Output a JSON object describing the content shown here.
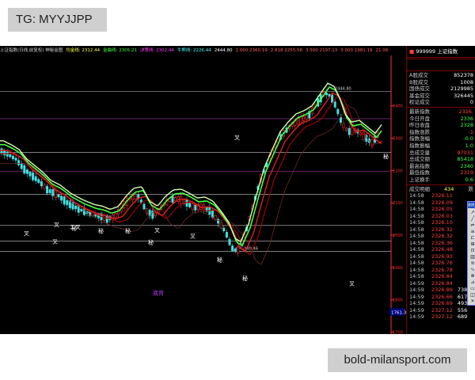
{
  "watermarks": {
    "top": "TG: MYYJJPP",
    "bottom": "bold-milansport.com"
  },
  "topbar": {
    "items": [
      {
        "text": "上证指数(日线,前复权) 神秘金图",
        "color": "#d0d0d0"
      },
      {
        "text": "均金线: 2312.44",
        "color": "#ffff40"
      },
      {
        "text": "金曲线: 2305.21",
        "color": "#40ff40"
      },
      {
        "text": "决策线: 2302.44",
        "color": "#ff40ff"
      },
      {
        "text": "牛熊线: 2226.44",
        "color": "#40ffff"
      },
      {
        "text": "2444.80",
        "color": "#ffffff"
      },
      {
        "text": "1.000 2360.19",
        "color": "#ff6060"
      },
      {
        "text": "2.618 2255.58",
        "color": "#ff6060"
      },
      {
        "text": "3.500 2197.13",
        "color": "#ff6060"
      },
      {
        "text": "5.000 1981.19",
        "color": "#ff6060"
      },
      {
        "text": "21.06",
        "color": "#ff6060"
      }
    ]
  },
  "chart_data": {
    "type": "candlestick",
    "title": "上证指数(日线,前复权)",
    "ylim": [
      1650,
      2600
    ],
    "y_ticks": [
      2400,
      2300,
      2200,
      2100,
      2000,
      1900,
      1800,
      1700
    ],
    "ohlc_generator": "synthetic approximation of 上证指数 daily candles",
    "price_path": [
      [
        0,
        2262
      ],
      [
        10,
        2250
      ],
      [
        20,
        2235
      ],
      [
        30,
        2205
      ],
      [
        40,
        2185
      ],
      [
        50,
        2165
      ],
      [
        60,
        2140
      ],
      [
        72,
        2125
      ],
      [
        85,
        2100
      ],
      [
        100,
        2080
      ],
      [
        115,
        2065
      ],
      [
        125,
        2060
      ],
      [
        135,
        2050
      ],
      [
        145,
        2058
      ],
      [
        155,
        2090
      ],
      [
        165,
        2115
      ],
      [
        175,
        2120
      ],
      [
        185,
        2075
      ],
      [
        195,
        2060
      ],
      [
        205,
        2090
      ],
      [
        215,
        2110
      ],
      [
        225,
        2112
      ],
      [
        235,
        2100
      ],
      [
        245,
        2085
      ],
      [
        255,
        2088
      ],
      [
        265,
        2075
      ],
      [
        275,
        2045
      ],
      [
        285,
        2010
      ],
      [
        293,
        1960
      ],
      [
        300,
        1950
      ],
      [
        310,
        2005
      ],
      [
        320,
        2095
      ],
      [
        330,
        2180
      ],
      [
        340,
        2235
      ],
      [
        350,
        2290
      ],
      [
        360,
        2320
      ],
      [
        370,
        2345
      ],
      [
        380,
        2355
      ],
      [
        390,
        2370
      ],
      [
        400,
        2405
      ],
      [
        410,
        2440
      ],
      [
        418,
        2430
      ],
      [
        425,
        2395
      ],
      [
        432,
        2345
      ],
      [
        440,
        2320
      ],
      [
        450,
        2325
      ],
      [
        460,
        2305
      ],
      [
        470,
        2285
      ],
      [
        478,
        2312
      ]
    ],
    "levels": [
      {
        "label": "2444.80",
        "value": 2444.8,
        "color": "#c8c8c8"
      },
      {
        "label": "",
        "value": 2360.19,
        "color": "#a030a0"
      },
      {
        "label": "",
        "value": 2255.58,
        "color": "#c8c8c8"
      },
      {
        "label": "",
        "value": 2197.13,
        "color": "#a030a0"
      },
      {
        "label": "",
        "value": 2126,
        "color": "#c8c8c8"
      },
      {
        "label": "",
        "value": 2030,
        "color": "#c8c8c8"
      },
      {
        "label": "",
        "value": 1981.19,
        "color": "#c8c8c8"
      },
      {
        "label": "0~1949.46",
        "value": 1949.46,
        "color": "#c8c8c8"
      }
    ],
    "marker_labels": [
      {
        "text": "叉",
        "value": 2000
      },
      {
        "text": "叉",
        "value": 1974
      },
      {
        "text": "秘",
        "value": 2016
      },
      {
        "text": "叉",
        "value": 2027
      },
      {
        "text": "二叉",
        "value": 2020
      },
      {
        "text": "秘",
        "value": 2008
      },
      {
        "text": "秘",
        "value": 2008
      },
      {
        "text": "叉",
        "value": 2010
      },
      {
        "text": "叉",
        "value": 1992
      },
      {
        "text": "秘",
        "value": 1972
      },
      {
        "text": "秘",
        "value": 1918
      },
      {
        "text": "秘",
        "value": 1861
      },
      {
        "text": "叉",
        "value": 1845
      },
      {
        "text": "秘",
        "value": 2238
      },
      {
        "text": "叉",
        "value": 2297
      }
    ],
    "annotation": {
      "text": "底背",
      "value": 1815
    },
    "current_price_tag": {
      "text": "1761.3",
      "value": 1761.3
    }
  },
  "right_panel": {
    "header": {
      "code": "999999",
      "name": "上证指数"
    },
    "stats_a": [
      {
        "label": "A股成交",
        "value": "852378"
      },
      {
        "label": "B股成交",
        "value": "1008"
      },
      {
        "label": "国债成交",
        "value": "2129985"
      },
      {
        "label": "基金成交",
        "value": "326445"
      },
      {
        "label": "权证成交",
        "value": "0"
      }
    ],
    "stats_b": [
      {
        "label": "最新指数",
        "value": "2326."
      },
      {
        "label": "今日开盘",
        "value": "2336"
      },
      {
        "label": "昨日收盘",
        "value": "2328"
      },
      {
        "label": "指数涨跌",
        "value": "-1"
      },
      {
        "label": "指数涨幅",
        "value": "-0.0"
      },
      {
        "label": "指数振幅",
        "value": "1.0"
      },
      {
        "label": "总成交量",
        "value": "97031"
      },
      {
        "label": "总成交额",
        "value": "85418"
      },
      {
        "label": "最高指数",
        "value": "2340"
      },
      {
        "label": "最低指数",
        "value": "2319"
      },
      {
        "label": "上证换手",
        "value": "0.6"
      }
    ],
    "ticks_header": {
      "label": "成交明细",
      "count": "434",
      "tail": "跌"
    },
    "ticks": [
      {
        "time": "14:58",
        "price": "2326.11"
      },
      {
        "time": "14:58",
        "price": "2326.09"
      },
      {
        "time": "14:58",
        "price": "2326.05"
      },
      {
        "time": "14:58",
        "price": "2326.03"
      },
      {
        "time": "14:58",
        "price": "2326.10"
      },
      {
        "time": "14:58",
        "price": "2326.32"
      },
      {
        "time": "14:58",
        "price": "2326.32"
      },
      {
        "time": "14:58",
        "price": "2326.36"
      },
      {
        "time": "14:58",
        "price": "2326.48"
      },
      {
        "time": "14:58",
        "price": "2326.93"
      },
      {
        "time": "14:58",
        "price": "2326.76"
      },
      {
        "time": "14:58",
        "price": "2326.78"
      },
      {
        "time": "14:58",
        "price": "2326.84"
      },
      {
        "time": "14:59",
        "price": "2326.84"
      },
      {
        "time": "14:59",
        "price": "2326.89"
      },
      {
        "time": "14:59",
        "price": "2326.66"
      },
      {
        "time": "14:59",
        "price": "2326.69"
      },
      {
        "time": "14:59",
        "price": "2327.12"
      },
      {
        "time": "14:59",
        "price": "2327.12"
      }
    ],
    "tick_volumes": [
      "7382",
      "617",
      "493",
      "556",
      "689"
    ]
  },
  "toolbox": {
    "title": "画线工具",
    "tools": [
      "↗",
      "╱",
      "⇌",
      "≡",
      "⊏",
      "⊞",
      "⊡",
      "▥",
      "≋",
      "∿",
      "⊗",
      "⊿",
      "▭",
      "◫",
      "✕"
    ]
  },
  "colors": {
    "background": "#000000",
    "up": "#ff3030",
    "down": "#40e0e0",
    "ma_green_light": "#d0ffb0",
    "ma_green": "#40ff40",
    "ma_red": "#e02020",
    "ma_dark_red": "#a00000",
    "grid": "#7a0000",
    "axis_red": "#ff3030",
    "marker_text": "#ffffff",
    "annotation": "#c040ff",
    "price_tag_bg": "#000080"
  }
}
